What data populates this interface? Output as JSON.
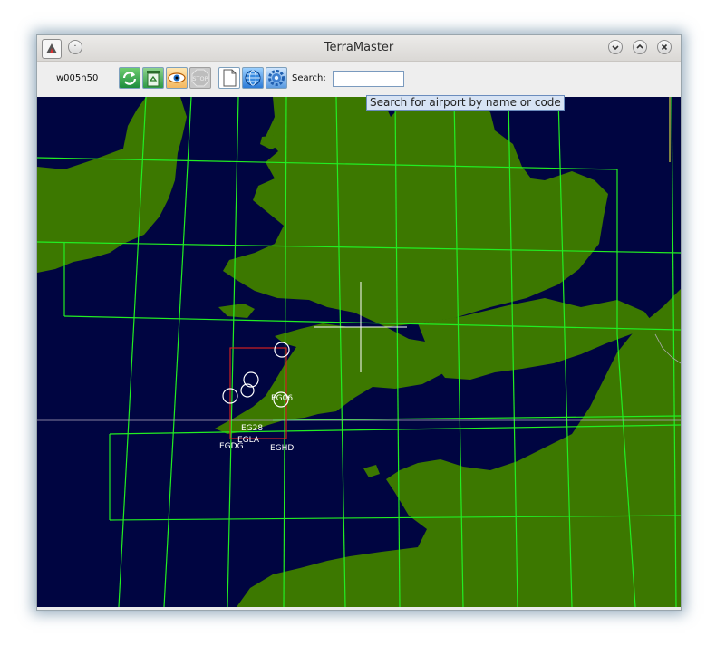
{
  "window": {
    "title": "TerraMaster"
  },
  "toolbar": {
    "tile_label": "w005n50",
    "buttons": [
      {
        "name": "sync-button",
        "icon": "sync-icon"
      },
      {
        "name": "delete-button",
        "icon": "recycle-trash-icon"
      },
      {
        "name": "show-button",
        "icon": "eye-icon"
      },
      {
        "name": "stop-button",
        "icon": "stop-icon",
        "label": "STOP"
      },
      {
        "name": "new-button",
        "icon": "blank-page-icon"
      },
      {
        "name": "globe-button",
        "icon": "globe-icon"
      },
      {
        "name": "settings-button",
        "icon": "gear-icon"
      }
    ],
    "search_label": "Search:",
    "search_value": ""
  },
  "tooltip": "Search for airport by name or code",
  "airports": [
    "EG06",
    "EG28",
    "EGLA",
    "EGDG",
    "EGHD"
  ],
  "colors": {
    "sea": "#000541",
    "land": "#3c7800",
    "grid": "#22ee22",
    "selection": "#d02020"
  }
}
